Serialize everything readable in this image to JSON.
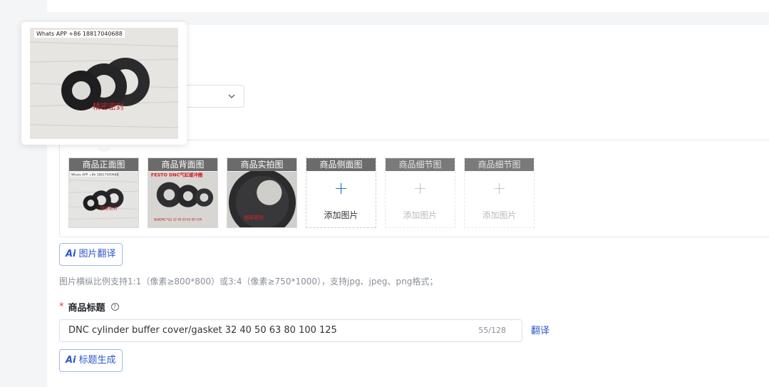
{
  "colors": {
    "accent": "#2c58c8",
    "required": "#e83a30",
    "slot_header_bg": "#6b6b6b"
  },
  "image_slots": [
    {
      "label": "商品正面图",
      "state": "filled",
      "watermark": "Whats APP +86 18817040688",
      "stamp": "精密密封"
    },
    {
      "label": "商品背面图",
      "state": "filled",
      "caption_top": "FESTO DNC气缸缓冲圈",
      "caption_bottom": "其他DNC气缸 32 40 50 63 80 100"
    },
    {
      "label": "商品实拍图",
      "state": "filled",
      "stamp": "精密密封"
    },
    {
      "label": "商品侧面图",
      "state": "empty",
      "add_text": "添加图片"
    },
    {
      "label": "商品细节图",
      "state": "disabled",
      "add_text": "添加图片"
    },
    {
      "label": "商品细节图",
      "state": "disabled",
      "add_text": "添加图片"
    }
  ],
  "image_translate_button": {
    "ai_text": "Ai",
    "label": "图片翻译"
  },
  "image_hint": "图片横纵比例支持1:1（像素≥800*800）或3:4（像素≥750*1000），支持jpg、jpeg、png格式；",
  "title_field": {
    "label": "商品标题",
    "required_mark": "*",
    "value": "DNC cylinder buffer cover/gasket 32 40 50 63 80 100 125",
    "counter": "55/128",
    "translate_link": "翻译"
  },
  "title_generate_button": {
    "ai_text": "Ai",
    "label": "标题生成"
  },
  "preview_popover": {
    "watermark": "Whats APP +86 18817040688",
    "stamp": "精密密封"
  }
}
